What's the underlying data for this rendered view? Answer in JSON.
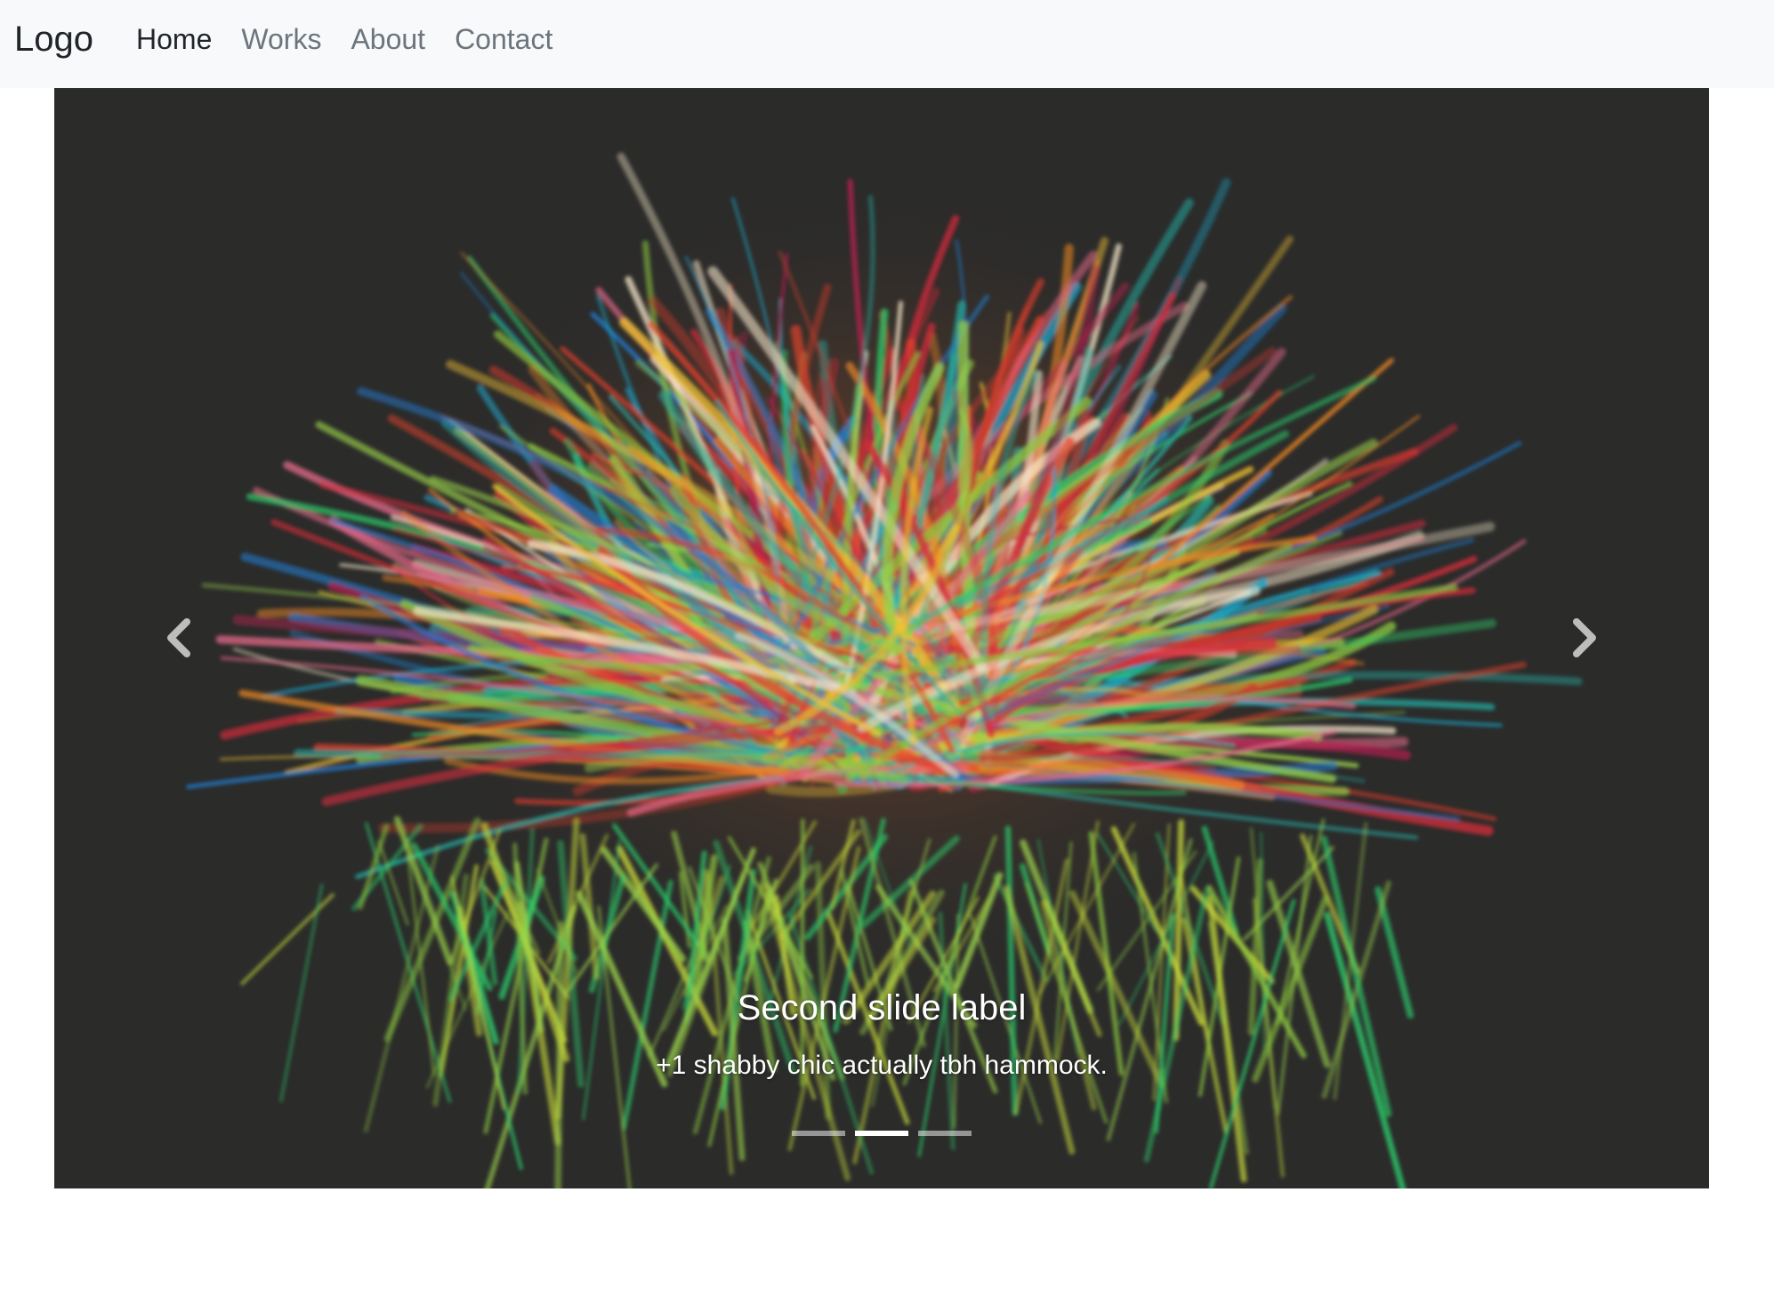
{
  "navbar": {
    "brand": "Logo",
    "links": [
      {
        "label": "Home",
        "active": true
      },
      {
        "label": "Works",
        "active": false
      },
      {
        "label": "About",
        "active": false
      },
      {
        "label": "Contact",
        "active": false
      }
    ]
  },
  "carousel": {
    "slide_count": 3,
    "active_index": 1,
    "caption_title": "Second slide label",
    "caption_text": "+1 shabby chic actually tbh hammock.",
    "prev_icon": "chevron-left-icon",
    "next_icon": "chevron-right-icon",
    "background_color": "#2b2b2a"
  }
}
